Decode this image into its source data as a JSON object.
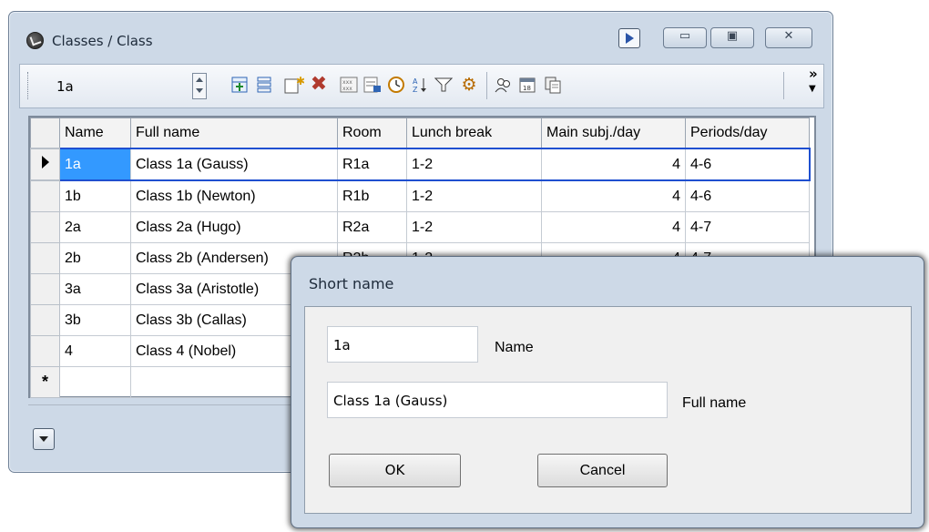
{
  "window": {
    "title": "Classes / Class",
    "caption_buttons": {
      "minimize": "▭",
      "maximize": "▣",
      "close": "✕"
    }
  },
  "toolbar": {
    "class_selector_value": "1a",
    "overflow_label": "»",
    "icons": [
      "new-row-icon",
      "list-icon",
      "new-item-icon",
      "delete-icon",
      "grid-icon",
      "report-icon",
      "clock-icon",
      "sort-icon",
      "filter-icon",
      "settings-icon",
      "people-icon",
      "calendar-icon",
      "copy-icon"
    ]
  },
  "grid": {
    "columns": [
      "Name",
      "Full name",
      "Room",
      "Lunch break",
      "Main subj./day",
      "Periods/day"
    ],
    "rows": [
      {
        "name": "1a",
        "full_name": "Class 1a (Gauss)",
        "room": "R1a",
        "lunch_break": "1-2",
        "main_subj_day": "4",
        "periods_day": "4-6"
      },
      {
        "name": "1b",
        "full_name": "Class 1b (Newton)",
        "room": "R1b",
        "lunch_break": "1-2",
        "main_subj_day": "4",
        "periods_day": "4-6"
      },
      {
        "name": "2a",
        "full_name": "Class 2a (Hugo)",
        "room": "R2a",
        "lunch_break": "1-2",
        "main_subj_day": "4",
        "periods_day": "4-7"
      },
      {
        "name": "2b",
        "full_name": "Class 2b (Andersen)",
        "room": "R2b",
        "lunch_break": "1-2",
        "main_subj_day": "4",
        "periods_day": "4-7"
      },
      {
        "name": "3a",
        "full_name": "Class 3a (Aristotle)",
        "room": "",
        "lunch_break": "",
        "main_subj_day": "",
        "periods_day": ""
      },
      {
        "name": "3b",
        "full_name": "Class 3b (Callas)",
        "room": "",
        "lunch_break": "",
        "main_subj_day": "",
        "periods_day": ""
      },
      {
        "name": "4",
        "full_name": "Class 4 (Nobel)",
        "room": "",
        "lunch_break": "",
        "main_subj_day": "",
        "periods_day": ""
      }
    ],
    "new_row_marker": "*"
  },
  "dialog": {
    "title": "Short name",
    "name_value": "1a",
    "name_label": "Name",
    "full_name_value": "Class 1a (Gauss)",
    "full_name_label": "Full name",
    "ok_label": "OK",
    "cancel_label": "Cancel"
  }
}
